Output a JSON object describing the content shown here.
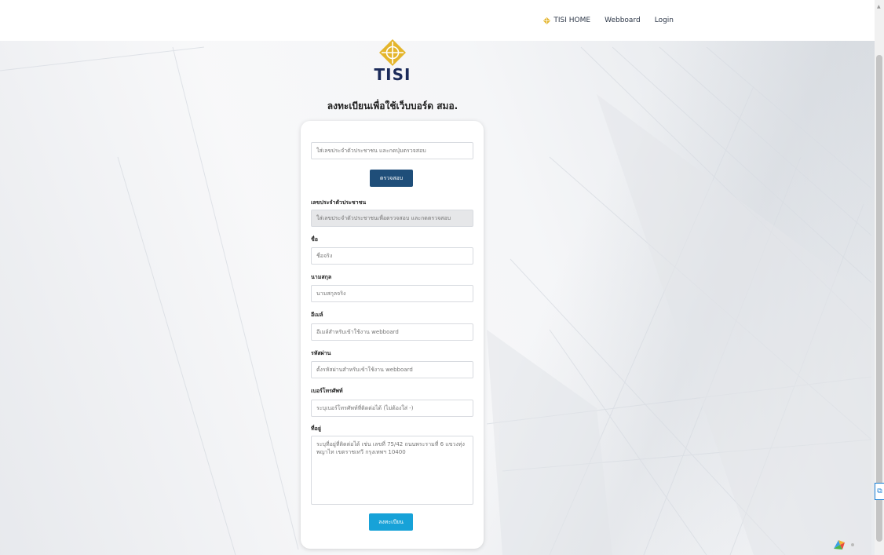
{
  "nav": {
    "items": [
      {
        "label": "TISI HOME",
        "icon": "tisi-logo-icon"
      },
      {
        "label": "Webboard"
      },
      {
        "label": "Login"
      }
    ]
  },
  "brand": {
    "logo_text": "TISI",
    "accent_color": "#e4b52c",
    "navy_color": "#1c2b5a"
  },
  "page": {
    "title": "ลงทะเบียนเพื่อใช้เว็บบอร์ด สมอ."
  },
  "form": {
    "id_search_placeholder": "ใส่เลขประจำตัวประชาชน และกดปุ่มตรวจสอบ",
    "check_button": "ตรวจสอบ",
    "id_label": "เลขประจำตัวประชาชน",
    "id_value_placeholder": "ใส่เลขประจำตัวประชาชนเพื่อตรวจสอบ และกดตรวจสอบ",
    "firstname_label": "ชื่อ",
    "firstname_placeholder": "ชื่อจริง",
    "lastname_label": "นามสกุล",
    "lastname_placeholder": "นามสกุลจริง",
    "email_label": "อีเมล์",
    "email_placeholder": "อีเมล์สำหรับเข้าใช้งาน webboard",
    "password_label": "รหัสผ่าน",
    "password_placeholder": "ตั้งรหัสผ่านสำหรับเข้าใช้งาน webboard",
    "phone_label": "เบอร์โทรศัพท์",
    "phone_placeholder": "ระบุเบอร์โทรศัพท์ที่ติดต่อได้ (ไม่ต้องใส่ -)",
    "address_label": "ที่อยู่",
    "address_placeholder": "ระบุที่อยู่ที่ติดต่อได้ เช่น เลขที่ 75/42 ถนนพระรามที่ 6 แขวงทุ่งพญาไท เขตราชเทวี กรุงเทพฯ 10400",
    "submit_button": "ลงทะเบียน"
  }
}
